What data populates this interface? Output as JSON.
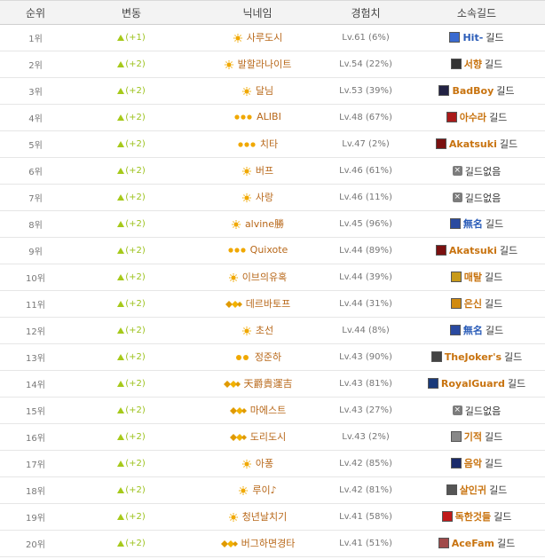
{
  "headers": {
    "rank": "순위",
    "change": "변동",
    "nickname": "닉네임",
    "exp": "경험치",
    "guild": "소속길드"
  },
  "colors": {
    "up": "#9cc21c",
    "nick": "#b8681a",
    "guild": "#c8730f",
    "guild_blue": "#2a5cb8"
  },
  "rows": [
    {
      "rank": "1위",
      "change": "(+1)",
      "badge": "sun-badge-icon",
      "nickname": "사루도시",
      "exp": "Lv.61 (6%)",
      "guild": "Hit-",
      "guild_suffix": "길드",
      "emblem": "#3a6ad0",
      "guild_blue": true
    },
    {
      "rank": "2위",
      "change": "(+2)",
      "badge": "sun-badge-icon",
      "nickname": "발할라나이트",
      "exp": "Lv.54 (22%)",
      "guild": "서향",
      "guild_suffix": "길드",
      "emblem": "#333333"
    },
    {
      "rank": "3위",
      "change": "(+2)",
      "badge": "sun-badge-icon",
      "nickname": "달님",
      "exp": "Lv.53 (39%)",
      "guild": "BadBoy",
      "guild_suffix": "길드",
      "emblem": "#222244"
    },
    {
      "rank": "4위",
      "change": "(+2)",
      "badge": "triple-sun-badge-icon",
      "nickname": "ALIBI",
      "exp": "Lv.48 (67%)",
      "guild": "아수라",
      "guild_suffix": "길드",
      "emblem": "#aa1a1a"
    },
    {
      "rank": "5위",
      "change": "(+2)",
      "badge": "triple-sun-badge-icon",
      "nickname": "치타",
      "exp": "Lv.47 (2%)",
      "guild": "Akatsuki",
      "guild_suffix": "길드",
      "emblem": "#7a1010"
    },
    {
      "rank": "6위",
      "change": "(+2)",
      "badge": "sun-badge-icon",
      "nickname": "버프",
      "exp": "Lv.46 (61%)",
      "guild": "",
      "guild_suffix": "",
      "none": "길드없음"
    },
    {
      "rank": "7위",
      "change": "(+2)",
      "badge": "sun-badge-icon",
      "nickname": "사랑",
      "exp": "Lv.46 (11%)",
      "guild": "",
      "guild_suffix": "",
      "none": "길드없음"
    },
    {
      "rank": "8위",
      "change": "(+2)",
      "badge": "sun-badge-icon",
      "nickname": "alvine勝",
      "exp": "Lv.45 (96%)",
      "guild": "無名",
      "guild_suffix": "길드",
      "emblem": "#2a4aa0",
      "guild_blue": true
    },
    {
      "rank": "9위",
      "change": "(+2)",
      "badge": "triple-sun-badge-icon",
      "nickname": "Quixote",
      "exp": "Lv.44 (89%)",
      "guild": "Akatsuki",
      "guild_suffix": "길드",
      "emblem": "#7a1010"
    },
    {
      "rank": "10위",
      "change": "(+2)",
      "badge": "sun-badge-icon",
      "nickname": "이브의유혹",
      "exp": "Lv.44 (39%)",
      "guild": "매탈",
      "guild_suffix": "길드",
      "emblem": "#c89a1a"
    },
    {
      "rank": "11위",
      "change": "(+2)",
      "badge": "diamond-badge-icon",
      "nickname": "데르바토프",
      "exp": "Lv.44 (31%)",
      "guild": "은신",
      "guild_suffix": "길드",
      "emblem": "#d08a10"
    },
    {
      "rank": "12위",
      "change": "(+2)",
      "badge": "sun-badge-icon",
      "nickname": "초선",
      "exp": "Lv.44 (8%)",
      "guild": "無名",
      "guild_suffix": "길드",
      "emblem": "#2a4aa0",
      "guild_blue": true
    },
    {
      "rank": "13위",
      "change": "(+2)",
      "badge": "double-sun-badge-icon",
      "nickname": "정준하",
      "exp": "Lv.43 (90%)",
      "guild": "TheJoker's",
      "guild_suffix": "길드",
      "emblem": "#444444"
    },
    {
      "rank": "14위",
      "change": "(+2)",
      "badge": "diamond-badge-icon",
      "nickname": "天爵貴運吉",
      "exp": "Lv.43 (81%)",
      "guild": "RoyalGuard",
      "guild_suffix": "길드",
      "emblem": "#1a3a7a"
    },
    {
      "rank": "15위",
      "change": "(+2)",
      "badge": "diamond-badge-icon",
      "nickname": "마에스트",
      "exp": "Lv.43 (27%)",
      "guild": "",
      "guild_suffix": "",
      "none": "길드없음"
    },
    {
      "rank": "16위",
      "change": "(+2)",
      "badge": "diamond-badge-icon",
      "nickname": "도리도시",
      "exp": "Lv.43 (2%)",
      "guild": "기적",
      "guild_suffix": "길드",
      "emblem": "#888888"
    },
    {
      "rank": "17위",
      "change": "(+2)",
      "badge": "sun-badge-icon",
      "nickname": "아퐁",
      "exp": "Lv.42 (85%)",
      "guild": "음악",
      "guild_suffix": "길드",
      "emblem": "#1a2a6a"
    },
    {
      "rank": "18위",
      "change": "(+2)",
      "badge": "sun-badge-icon",
      "nickname": "루이♪",
      "exp": "Lv.42 (81%)",
      "guild": "살인귀",
      "guild_suffix": "길드",
      "emblem": "#555555"
    },
    {
      "rank": "19위",
      "change": "(+2)",
      "badge": "sun-badge-icon",
      "nickname": "청년날치기",
      "exp": "Lv.41 (58%)",
      "guild": "독한것들",
      "guild_suffix": "길드",
      "emblem": "#c01a1a"
    },
    {
      "rank": "20위",
      "change": "(+2)",
      "badge": "diamond-badge-icon",
      "nickname": "버그하면경타",
      "exp": "Lv.41 (51%)",
      "guild": "AceFam",
      "guild_suffix": "길드",
      "emblem": "#a04a4a"
    }
  ]
}
